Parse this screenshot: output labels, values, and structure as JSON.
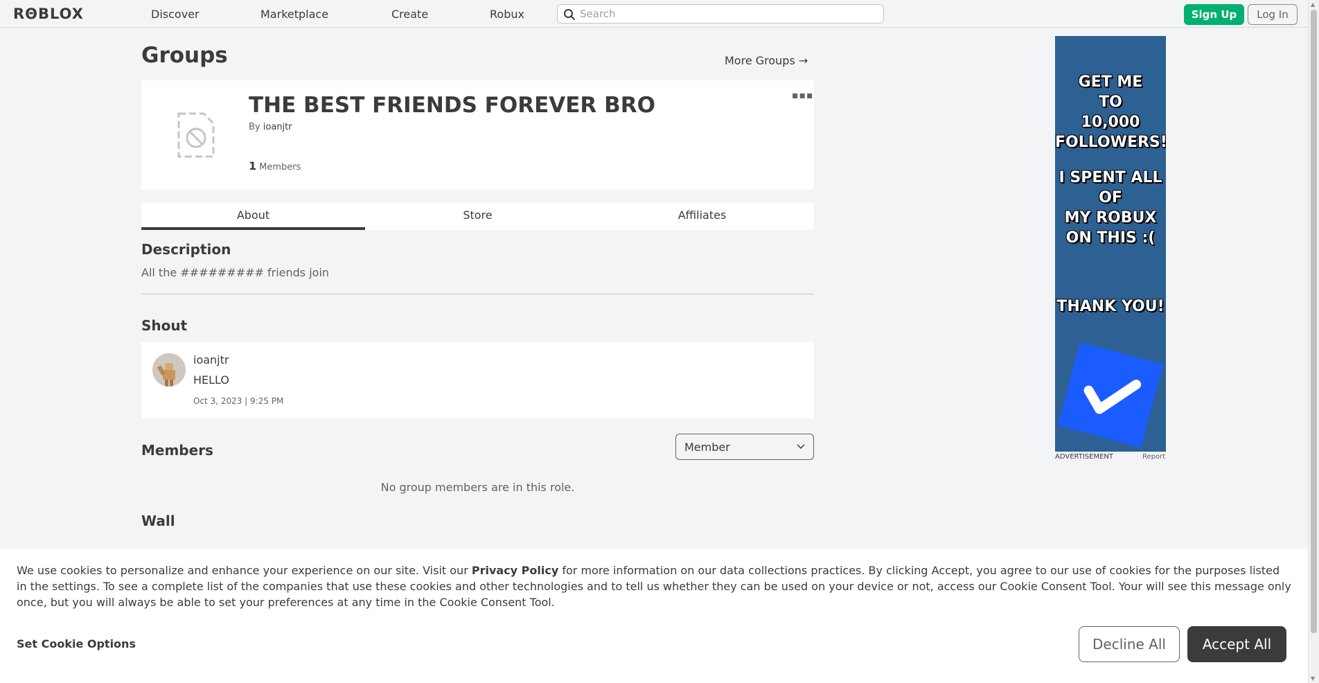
{
  "nav": {
    "logo": "RΘBLOX",
    "links": [
      "Discover",
      "Marketplace",
      "Create",
      "Robux"
    ],
    "search_placeholder": "Search",
    "sign_up": "Sign Up",
    "log_in": "Log In"
  },
  "page": {
    "title": "Groups",
    "more_groups": "More Groups →"
  },
  "group": {
    "name": "THE BEST FRIENDS FOREVER BRO",
    "by_label": "By",
    "owner": "ioanjtr",
    "member_count": "1",
    "members_label": "Members",
    "more_icon": "more-dots-icon"
  },
  "tabs": [
    "About",
    "Store",
    "Affiliates"
  ],
  "about": {
    "description_heading": "Description",
    "description_text": "All the ######### friends join",
    "shout_heading": "Shout",
    "shout": {
      "user": "ioanjtr",
      "message": "HELLO",
      "date": "Oct 3, 2023 | 9:25 PM"
    },
    "members_heading": "Members",
    "role_select": "Member",
    "no_members": "No group members are in this role.",
    "wall_heading": "Wall"
  },
  "ad": {
    "line1": "GET ME",
    "line2": "TO",
    "line3": "10,000",
    "line4": "FOLLOWERS!",
    "line5": "I SPENT ALL",
    "line6": "OF",
    "line7": "MY ROBUX",
    "line8": "ON THIS :(",
    "line9": "THANK YOU!",
    "label": "ADVERTISEMENT",
    "report": "Report"
  },
  "cookie": {
    "text_before": "We use cookies to personalize and enhance your experience on our site. Visit our ",
    "privacy_link": "Privacy Policy",
    "text_after": " for more information on our data collections practices. By clicking Accept, you agree to our use of cookies for the purposes listed in the settings. To see a complete list of the companies that use these cookies and other technologies and to tell us whether they can be used on your device or not, access our Cookie Consent Tool. Your will see this message only once, but you will always be able to set your preferences at any time in the Cookie Consent Tool.",
    "set_options": "Set Cookie Options",
    "decline": "Decline All",
    "accept": "Accept All"
  },
  "colors": {
    "signup_green": "#00b06f",
    "background": "#f2f4f5",
    "ad_blue": "#2e6193",
    "check_blue": "#1a5cff",
    "accept_dark": "#393b3d"
  }
}
